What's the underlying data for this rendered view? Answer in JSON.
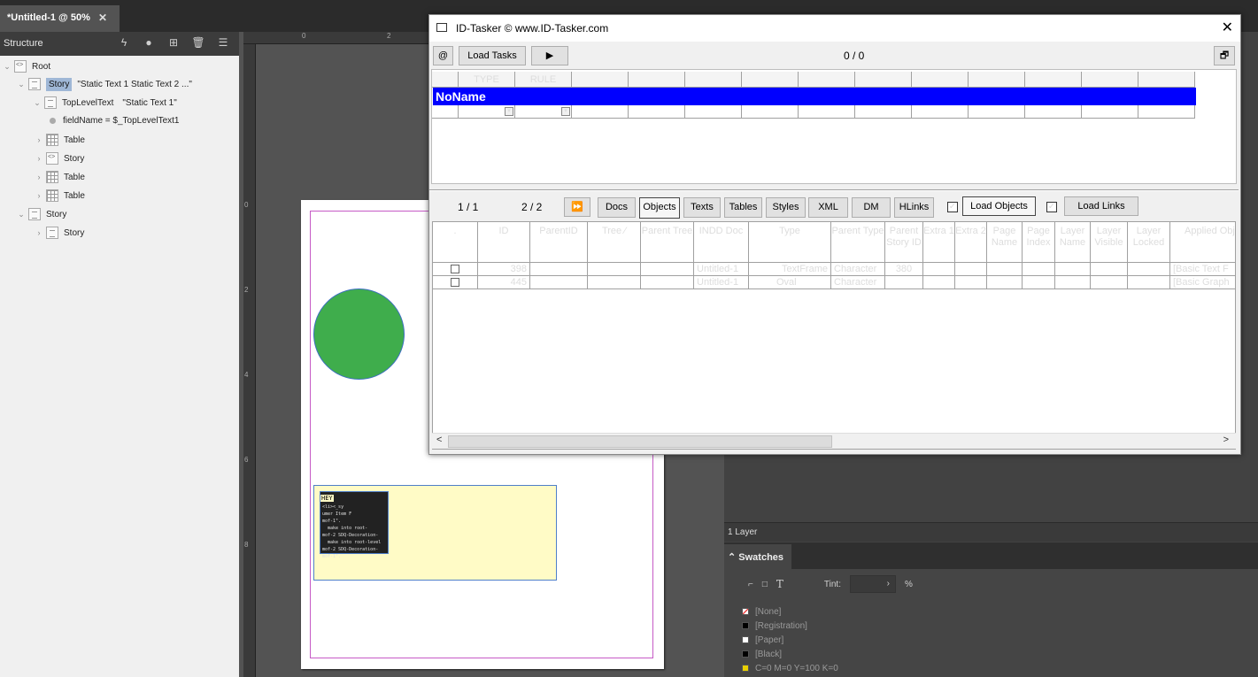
{
  "doc_tab": {
    "title": "*Untitled-1 @ 50%",
    "close": "✕"
  },
  "structure": {
    "title": "Structure",
    "nodes": {
      "root": "Root",
      "story1": "Story",
      "story1_value": "\"Static Text 1  Static Text 2     ...\"",
      "toplevel": "TopLevelText",
      "toplevel_value": "\"Static Text 1\"",
      "field": "fieldName = $_TopLevelText1",
      "table1": "Table",
      "story2": "Story",
      "table2": "Table",
      "table3": "Table",
      "story3": "Story",
      "story4": "Story"
    }
  },
  "rulers": {
    "top": [
      "0",
      "2",
      "4",
      "6"
    ],
    "left": [
      "0",
      "2",
      "4",
      "6",
      "8"
    ]
  },
  "page_text": {
    "heading": "HEY",
    "code_lines": [
      "   ",
      "<li><_sy",
      "umer Item F",
      "mof-1\".",
      "  make into root-",
      "mof-2 SDQ-Decoration-",
      "  make into root-level",
      "mof-2 SDQ-Decoration-",
      "mof-1\"."
    ]
  },
  "tasker": {
    "title": "ID-Tasker  © www.ID-Tasker.com",
    "close": "✕",
    "at_button": "@",
    "load_tasks": "Load Tasks",
    "play": "▶",
    "task_counter": "0 / 0",
    "restore": "🗗",
    "rule_headers": [
      "TYPE",
      "RULE"
    ],
    "rule_row_label": "NoName",
    "obj_counter_left": "1 / 1",
    "obj_counter_right": "2 / 2",
    "fast_forward": "⏩",
    "tabs": [
      "Docs",
      "Objects",
      "Texts",
      "Tables",
      "Styles",
      "XML",
      "DM",
      "HLinks"
    ],
    "load_objects": "Load Objects",
    "load_links": "Load Links",
    "check_mark": "✓",
    "columns": [
      ".",
      "ID",
      "ParentID",
      "Tree  ⁄",
      "Parent Tree",
      "INDD Doc",
      "Type",
      "Parent Type",
      "Parent Story ID",
      "Extra 1",
      "Extra 2",
      "Page Name",
      "Page Index",
      "Layer Name",
      "Layer Visible",
      "Layer Locked",
      "Applied Obj"
    ],
    "rows": [
      {
        "id": "398",
        "indd_doc": "Untitled-1",
        "type": "TextFrame",
        "parent_type": "Character",
        "parent_story_id": "380",
        "applied": "[Basic Text F"
      },
      {
        "id": "445",
        "indd_doc": "Untitled-1",
        "type": "Oval",
        "parent_type": "Character",
        "parent_story_id": "",
        "applied": "[Basic Graph"
      }
    ],
    "scroll_left": "<",
    "scroll_right": ">"
  },
  "layers": {
    "footer": "1 Layer"
  },
  "swatches": {
    "tab": "Swatches",
    "tint_label": "Tint:",
    "tint_value": "",
    "percent": "%",
    "items": [
      {
        "name": "[None]",
        "color": "#ffffff"
      },
      {
        "name": "[Registration]",
        "color": "#000000"
      },
      {
        "name": "[Paper]",
        "color": "#ffffff"
      },
      {
        "name": "[Black]",
        "color": "#000000"
      },
      {
        "name": "C=0 M=0 Y=100 K=0",
        "color": "#fff200"
      }
    ]
  }
}
